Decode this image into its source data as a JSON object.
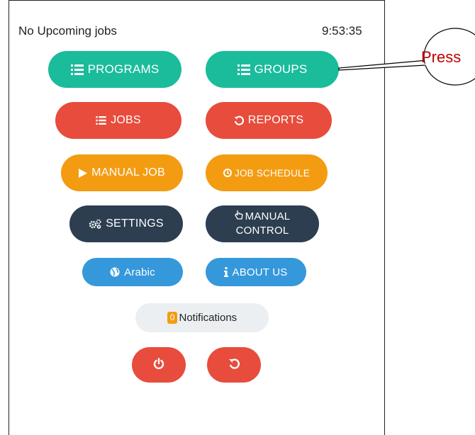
{
  "header": {
    "status_text": "No Upcoming jobs",
    "clock": "9:53:35"
  },
  "buttons": {
    "programs": "PROGRAMS",
    "groups": "GROUPS",
    "jobs": "JOBS",
    "reports": "REPORTS",
    "manual_job": "MANUAL JOB",
    "job_schedule": "JOB SCHEDULE",
    "settings": "SETTINGS",
    "manual_control_line1": "MANUAL",
    "manual_control_line2": "CONTROL",
    "arabic": "Arabic",
    "about_us": "ABOUT US",
    "notifications_count": "0",
    "notifications": "Notifications"
  },
  "callout": {
    "text": "Press"
  },
  "colors": {
    "green": "#1abc9c",
    "red": "#e74c3c",
    "orange": "#f39c12",
    "navy": "#2c3e50",
    "blue": "#3498db",
    "callout_text": "#c00000"
  },
  "icons": {
    "programs": "list-icon",
    "groups": "list-icon",
    "jobs": "list-icon",
    "reports": "history-icon",
    "manual_job": "play-icon",
    "job_schedule": "clock-icon",
    "settings": "gears-icon",
    "manual_control": "hand-pointer-icon",
    "arabic": "globe-icon",
    "about_us": "info-icon",
    "power": "power-icon",
    "restart": "restart-icon"
  }
}
